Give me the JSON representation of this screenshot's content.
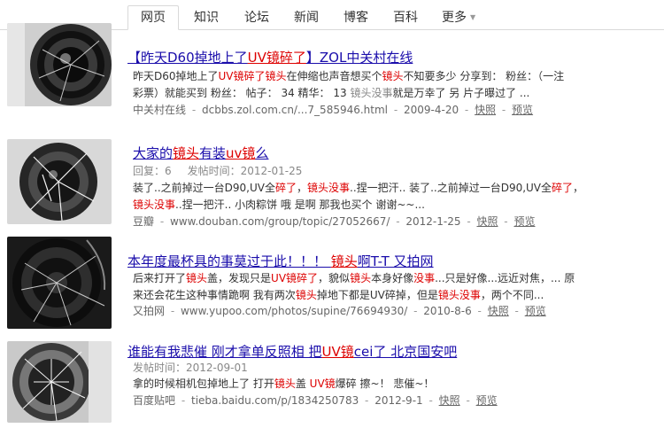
{
  "tabs": [
    {
      "label": "网页",
      "active": true
    },
    {
      "label": "知识"
    },
    {
      "label": "论坛"
    },
    {
      "label": "新闻"
    },
    {
      "label": "博客"
    },
    {
      "label": "百科"
    },
    {
      "label": "更多",
      "caret": "▼"
    }
  ],
  "results": [
    {
      "title": [
        "【昨天D60掉地上了",
        "UV镜碎了",
        "】ZOL中关村在线"
      ],
      "snippet_lines": [
        [
          "昨天D60掉地上了",
          "UV镜碎了镜头",
          "在伸缩也声音想买个",
          "镜头",
          "不知要多少 分享到： 粉丝：（一注"
        ],
        [
          "彩票）就能买到 粉丝： 帖子： 34 精华： 13 ",
          "镜头没事",
          "就是万幸了 另 片子曝过了 ..."
        ]
      ],
      "source": "中关村在线",
      "url": "dcbbs.zol.com.cn/...7_585946.html",
      "date": "2009-4-20",
      "snapshot": "快照",
      "preview": "预览"
    },
    {
      "title": [
        "大家的",
        "镜头",
        "有装",
        "uv镜",
        "么"
      ],
      "meta_reply": "回复：6",
      "meta_time": "发帖时间：2012-01-25",
      "snippet_lines": [
        [
          "装了..之前掉过一台D90,UV全",
          "碎了",
          "，",
          "镜头没事",
          "..捏一把汗.. 装了..之前掉过一台D90,UV全",
          "碎了",
          "，"
        ],
        [
          "镜头没事",
          "..捏一把汗.. 小肉粽饼 哦 是啊 那我也买个 谢谢~~..."
        ]
      ],
      "source": "豆瓣",
      "url": "www.douban.com/group/topic/27052667/",
      "date": "2012-1-25",
      "snapshot": "快照",
      "preview": "预览"
    },
    {
      "title": [
        "本年度最杯具的事莫过于此！！！ ",
        "镜头",
        "啊T-T  又拍网"
      ],
      "snippet_lines": [
        [
          "后来打开了",
          "镜头",
          "盖，发现只是",
          "UV镜碎了",
          "，貌似",
          "镜头",
          "本身好像",
          "没事",
          "...只是好像...远近对焦，... 原"
        ],
        [
          "来还会花生这种事情跪啊 我有两次",
          "镜头",
          "掉地下都是UV碎掉，但是",
          "镜头没事",
          "，两个不同..."
        ]
      ],
      "source": "又拍网",
      "url": "www.yupoo.com/photos/supine/76694930/",
      "date": "2010-8-6",
      "snapshot": "快照",
      "preview": "预览"
    },
    {
      "title": [
        "谁能有我悲催 刚才拿单反照相 把",
        "UV镜",
        "cei了  北京国安吧"
      ],
      "meta_time": "发帖时间：2012-09-01",
      "snippet_lines": [
        [
          "拿的时候相机包掉地上了 打开",
          "镜头",
          "盖 ",
          "UV镜",
          "爆碎 擦~！ 悲催~！"
        ]
      ],
      "source": "百度贴吧",
      "url": "tieba.baidu.com/p/1834250783",
      "date": "2012-9-1",
      "snapshot": "快照",
      "preview": "预览"
    }
  ],
  "colors": {
    "link": "#1a0dab",
    "highlight": "#dd0000",
    "gray": "#888888"
  }
}
